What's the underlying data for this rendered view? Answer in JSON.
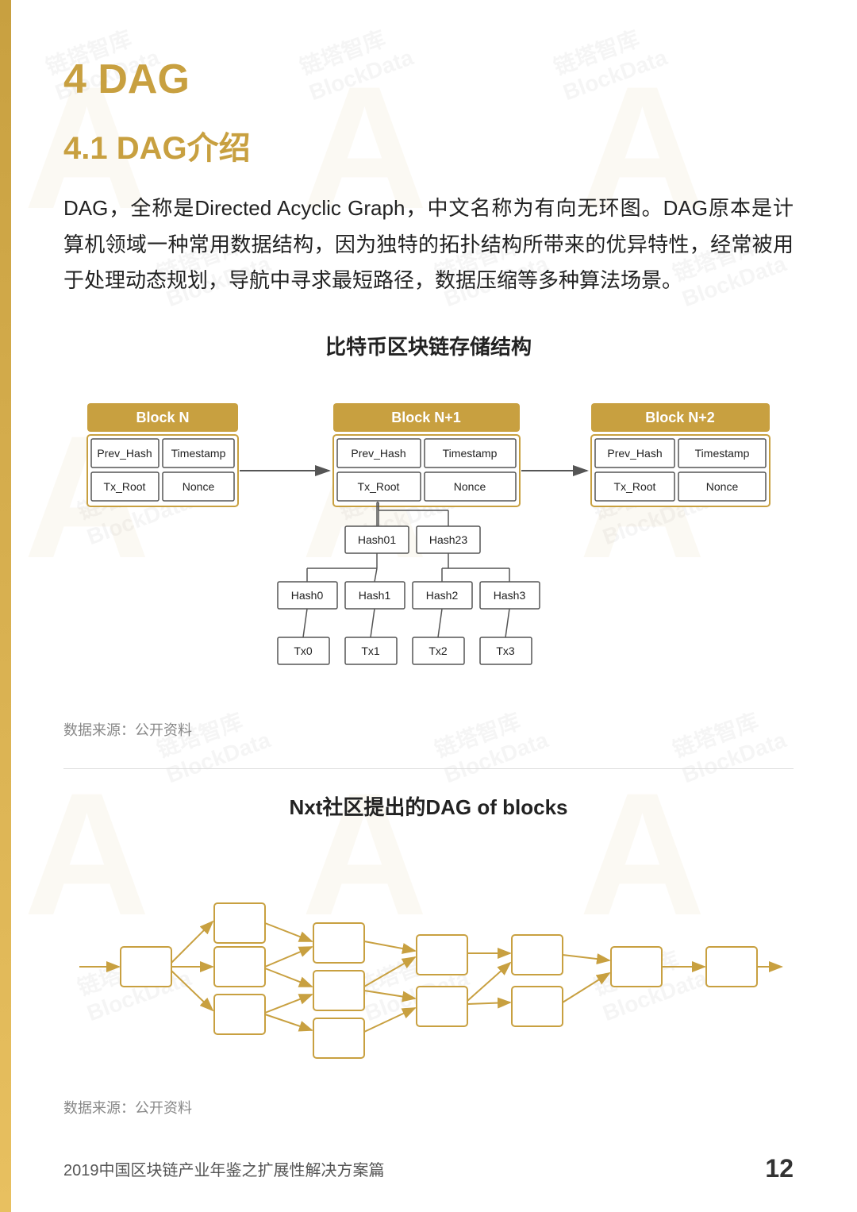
{
  "page": {
    "chapter": "4 DAG",
    "section": "4.1 DAG介绍",
    "body_text": "DAG，全称是Directed Acyclic Graph，中文名称为有向无环图。DAG原本是计算机领域一种常用数据结构，因为独特的拓扑结构所带来的优异特性，经常被用于处理动态规划，导航中寻求最短路径，数据压缩等多种算法场景。",
    "diagram1_title": "比特币区块链存储结构",
    "source_note1": "数据来源：公开资料",
    "diagram2_title": "Nxt社区提出的DAG of blocks",
    "source_note2": "数据来源：公开资料",
    "footer_text": "2019中国区块链产业年鉴之扩展性解决方案篇",
    "page_number": "12",
    "blocks": {
      "block_n": {
        "label": "Block N",
        "fields": [
          "Prev_Hash",
          "Timestamp",
          "Tx_Root",
          "Nonce"
        ]
      },
      "block_n1": {
        "label": "Block N+1",
        "fields": [
          "Prev_Hash",
          "Timestamp",
          "Tx_Root",
          "Nonce"
        ]
      },
      "block_n2": {
        "label": "Block N+2",
        "fields": [
          "Prev_Hash",
          "Timestamp",
          "Tx_Root",
          "Nonce"
        ]
      },
      "merkle": [
        "Hash01",
        "Hash23",
        "Hash0",
        "Hash1",
        "Hash2",
        "Hash3",
        "Tx0",
        "Tx1",
        "Tx2",
        "Tx3"
      ]
    }
  }
}
